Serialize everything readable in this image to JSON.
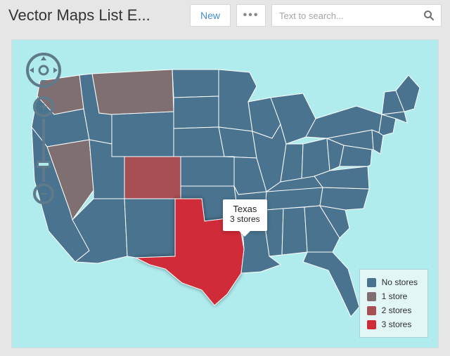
{
  "header": {
    "title": "Vector Maps List E...",
    "new_label": "New",
    "more_label": "•••",
    "search_placeholder": "Text to search..."
  },
  "tooltip": {
    "state": "Texas",
    "detail": "3 stores"
  },
  "legend": {
    "items": [
      {
        "label": "No stores",
        "class": "lg0"
      },
      {
        "label": "1 store",
        "class": "lg1"
      },
      {
        "label": "2 stores",
        "class": "lg2"
      },
      {
        "label": "3 stores",
        "class": "lg3"
      }
    ]
  },
  "controls": {
    "zoom_in": "+",
    "zoom_out": "−"
  },
  "colors": {
    "water": "#b0ecee",
    "default_state": "#49738f",
    "store1": "#806f70",
    "store2": "#a84f54",
    "store3": "#cf2b38"
  },
  "state_classes": {
    "Washington": "sc1",
    "Montana": "sc1",
    "Nevada": "sc1",
    "Colorado": "sc2",
    "Texas": "sc3"
  }
}
